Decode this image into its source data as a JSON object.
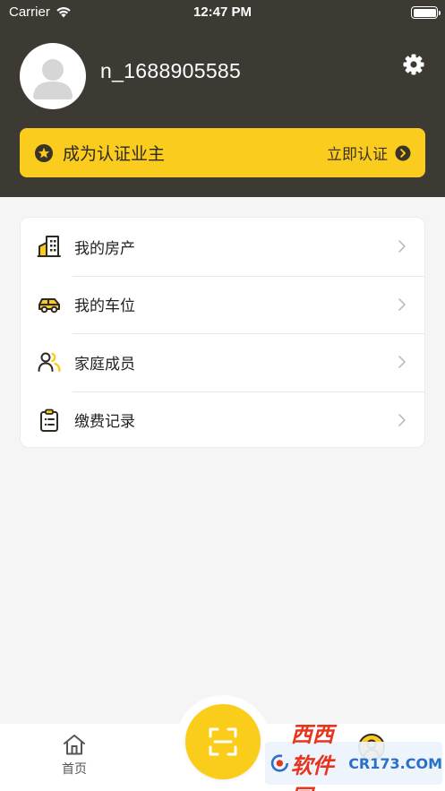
{
  "status_bar": {
    "carrier": "Carrier",
    "time": "12:47 PM"
  },
  "profile": {
    "username": "n_1688905585"
  },
  "verify_banner": {
    "title": "成为认证业主",
    "action": "立即认证"
  },
  "menu": {
    "items": [
      {
        "label": "我的房产",
        "icon": "building-icon"
      },
      {
        "label": "我的车位",
        "icon": "car-icon"
      },
      {
        "label": "家庭成员",
        "icon": "family-icon"
      },
      {
        "label": "缴费记录",
        "icon": "clipboard-icon"
      }
    ]
  },
  "tabbar": {
    "home_label": "首页"
  },
  "watermark": {
    "brand": "西西软件园",
    "site": "CR173.COM"
  },
  "colors": {
    "header_bg": "#3d3a34",
    "accent_yellow": "#f9cc1e",
    "page_bg": "#f5f5f5"
  }
}
